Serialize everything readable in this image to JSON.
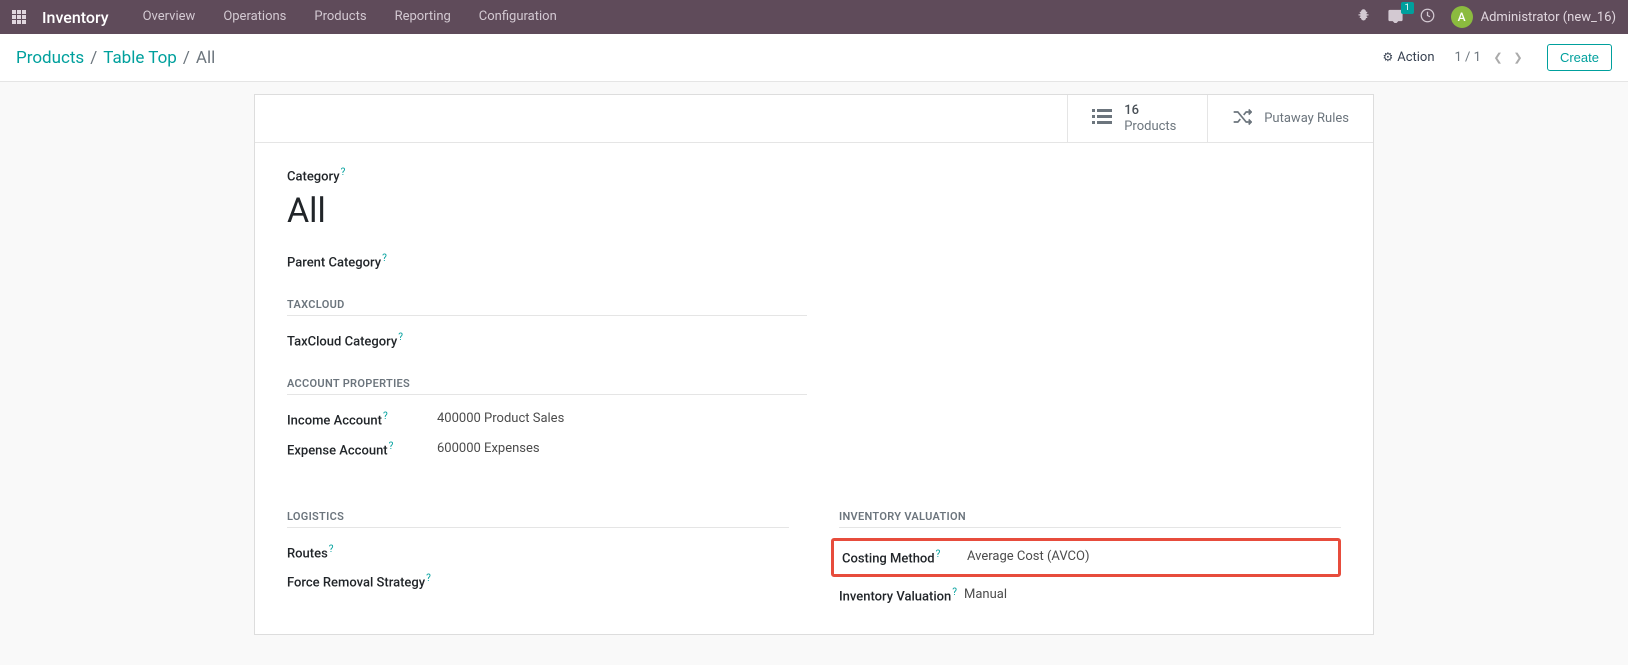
{
  "navbar": {
    "brand": "Inventory",
    "menu": [
      "Overview",
      "Operations",
      "Products",
      "Reporting",
      "Configuration"
    ],
    "messages_count": "1",
    "avatar_initial": "A",
    "user_name": "Administrator (new_16)"
  },
  "control_panel": {
    "breadcrumbs": [
      "Products",
      "Table Top",
      "All"
    ],
    "action_label": "Action",
    "pager": "1 / 1",
    "create_label": "Create"
  },
  "stat_buttons": {
    "products": {
      "count": "16",
      "label": "Products"
    },
    "putaway": {
      "label": "Putaway Rules"
    }
  },
  "form": {
    "category_label": "Category",
    "category_value": "All",
    "parent_category_label": "Parent Category",
    "sections": {
      "taxcloud": {
        "title": "TAXCLOUD",
        "taxcloud_category_label": "TaxCloud Category"
      },
      "account_properties": {
        "title": "ACCOUNT PROPERTIES",
        "income_account_label": "Income Account",
        "income_account_value": "400000 Product Sales",
        "expense_account_label": "Expense Account",
        "expense_account_value": "600000 Expenses"
      },
      "logistics": {
        "title": "LOGISTICS",
        "routes_label": "Routes",
        "force_removal_label": "Force Removal Strategy"
      },
      "inventory_valuation": {
        "title": "INVENTORY VALUATION",
        "costing_method_label": "Costing Method",
        "costing_method_value": "Average Cost (AVCO)",
        "inventory_valuation_label": "Inventory Valuation",
        "inventory_valuation_value": "Manual"
      }
    }
  }
}
